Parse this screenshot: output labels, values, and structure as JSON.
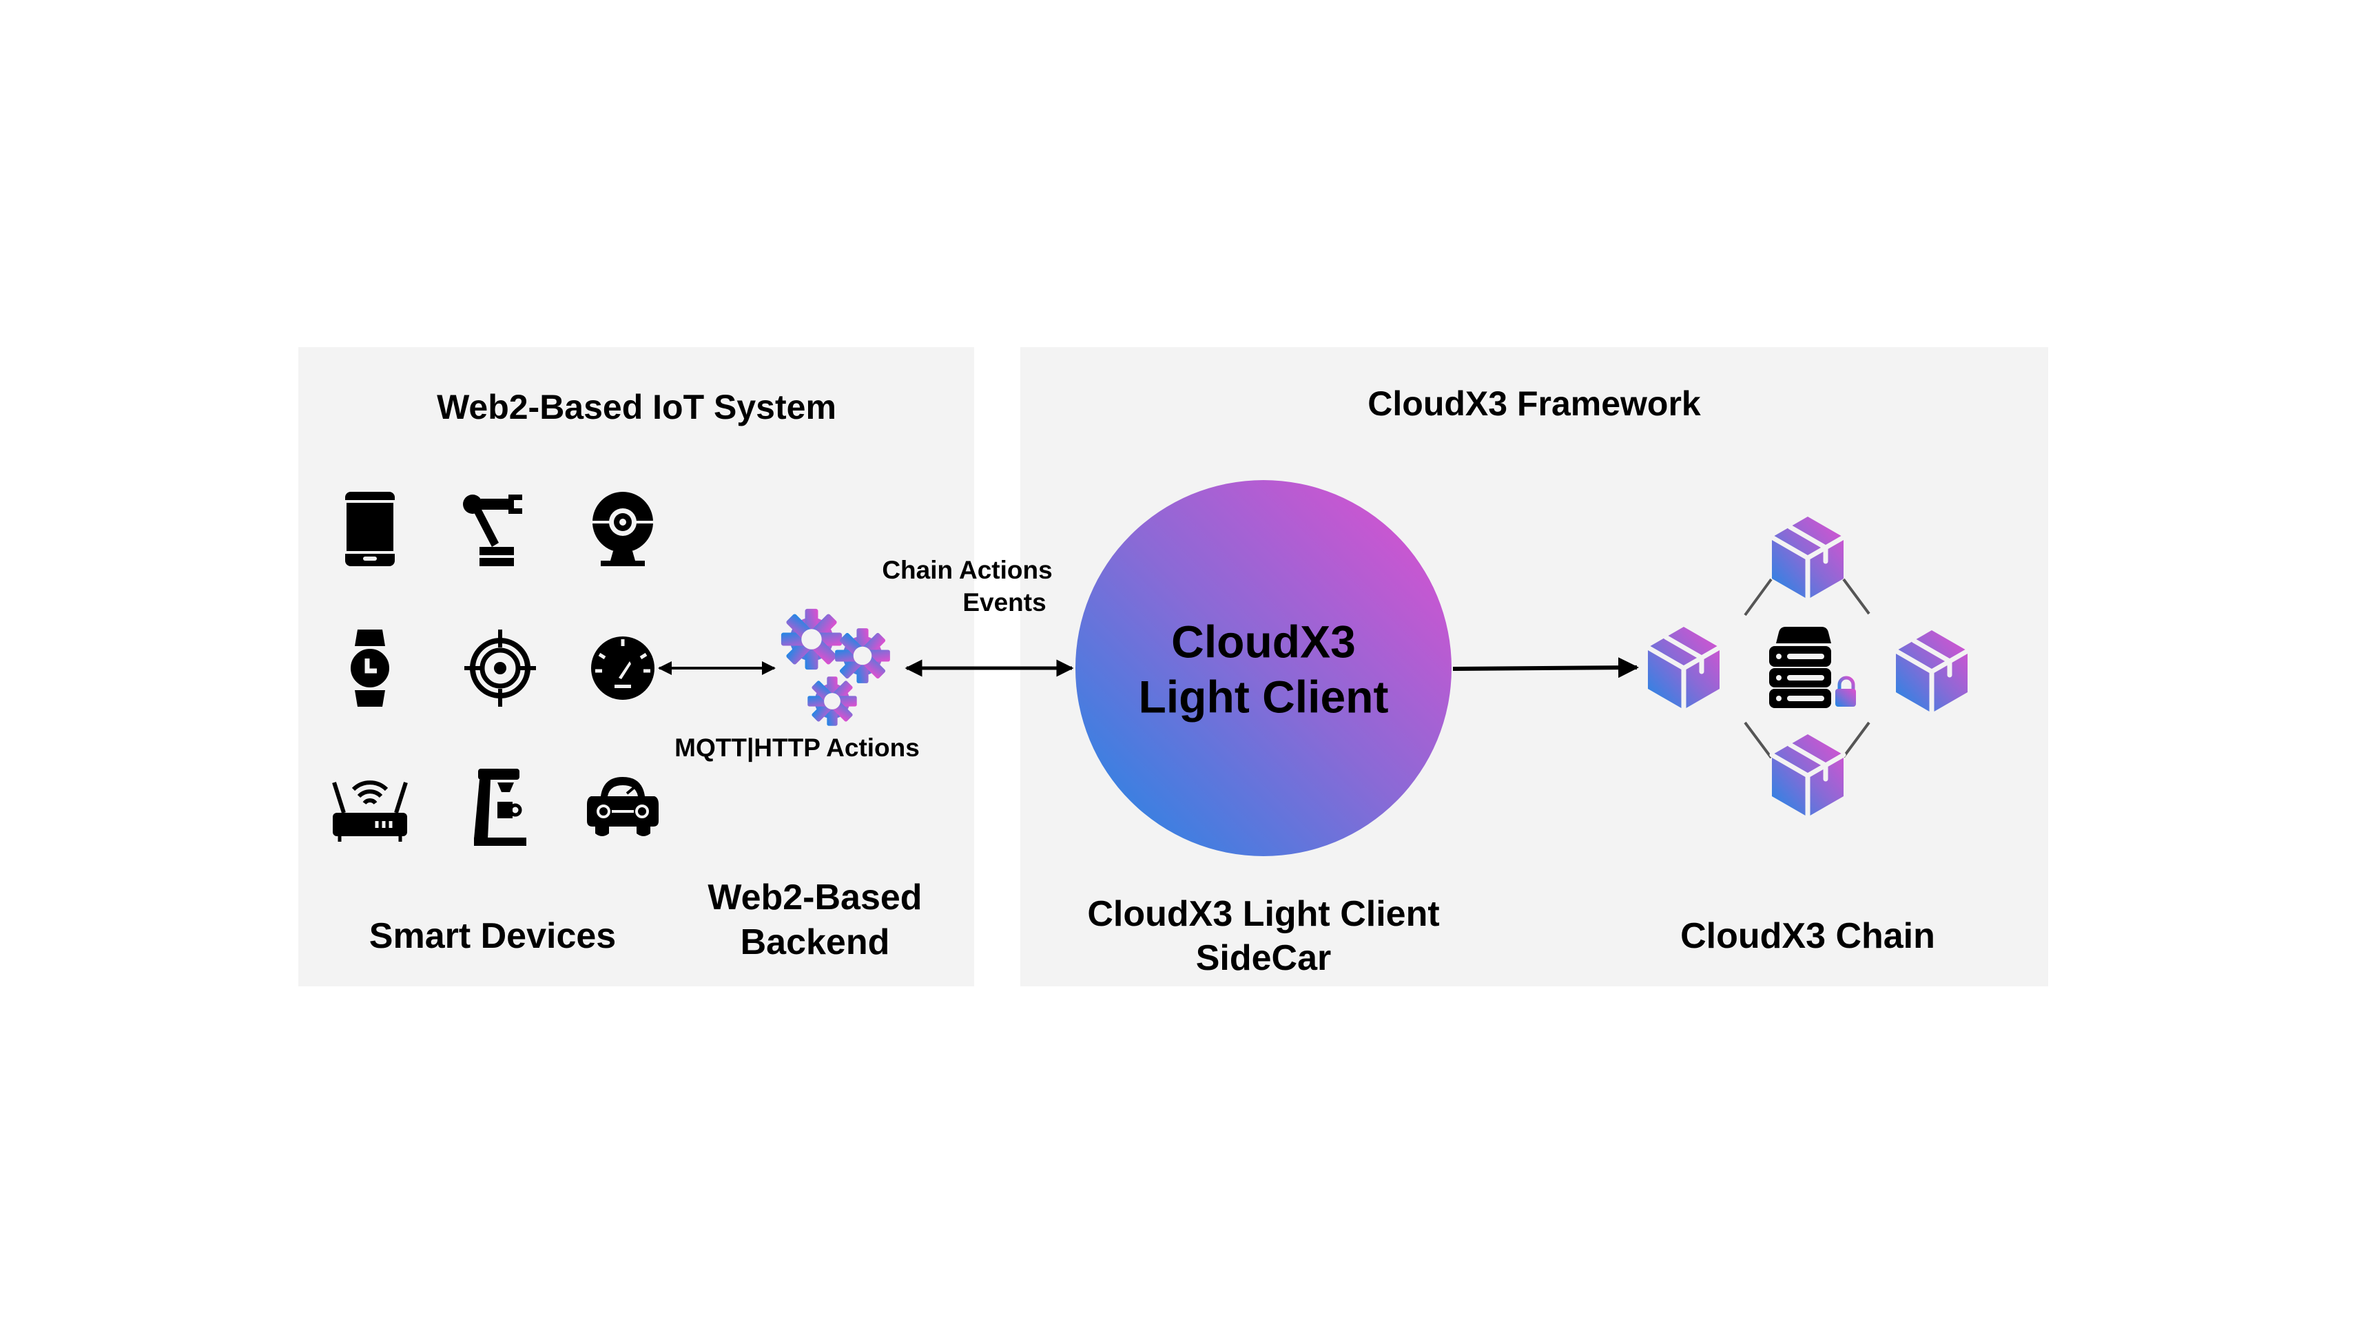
{
  "colors": {
    "gradient_start": "#1e88e5",
    "gradient_end": "#e14fcf",
    "panel_bg": "#f3f3f3",
    "link_line": "#555555"
  },
  "left_panel": {
    "title": "Web2-Based IoT System",
    "devices": [
      "smartphone-icon",
      "robot-arm-icon",
      "webcam-icon",
      "smartwatch-icon",
      "target-icon",
      "speedometer-icon",
      "wifi-router-icon",
      "coffee-machine-icon",
      "car-icon"
    ],
    "devices_label": "Smart Devices",
    "backend_label_line1": "Web2-Based",
    "backend_label_line2": "Backend",
    "mqtt_label": "MQTT|HTTP Actions"
  },
  "connector": {
    "line1": "Chain Actions",
    "line2": "Events"
  },
  "right_panel": {
    "title": "CloudX3 Framework",
    "light_client_line1": "CloudX3",
    "light_client_line2": "Light Client",
    "sidecar_label_line1": "CloudX3 Light Client",
    "sidecar_label_line2": "SideCar",
    "chain_label": "CloudX3 Chain"
  }
}
